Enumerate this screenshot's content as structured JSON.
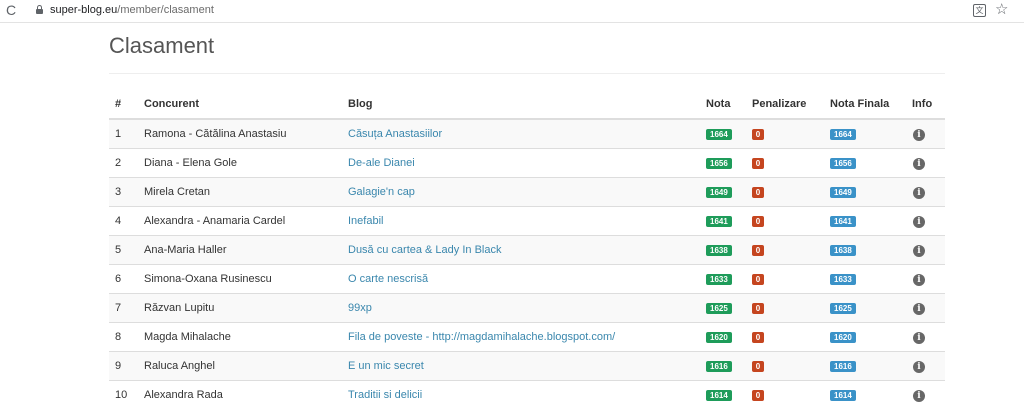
{
  "browser": {
    "url_domain": "super-blog.eu",
    "url_path": "/member/clasament",
    "reload_glyph": "C",
    "translate_glyph": "文",
    "star_glyph": "☆"
  },
  "page": {
    "title": "Clasament"
  },
  "table": {
    "headers": {
      "num": "#",
      "concurent": "Concurent",
      "blog": "Blog",
      "nota": "Nota",
      "penalizare": "Penalizare",
      "nota_finala": "Nota Finala",
      "info": "Info"
    },
    "rows": [
      {
        "num": "1",
        "name": "Ramona - Cătălina Anastasiu",
        "blog": "Căsuța Anastasiilor",
        "nota": "1664",
        "penalizare": "0",
        "nota_finala": "1664",
        "info": "i"
      },
      {
        "num": "2",
        "name": "Diana - Elena Gole",
        "blog": "De-ale Dianei",
        "nota": "1656",
        "penalizare": "0",
        "nota_finala": "1656",
        "info": "i"
      },
      {
        "num": "3",
        "name": "Mirela Cretan",
        "blog": "Galagie'n cap",
        "nota": "1649",
        "penalizare": "0",
        "nota_finala": "1649",
        "info": "i"
      },
      {
        "num": "4",
        "name": "Alexandra - Anamaria Cardel",
        "blog": "Inefabil",
        "nota": "1641",
        "penalizare": "0",
        "nota_finala": "1641",
        "info": "i"
      },
      {
        "num": "5",
        "name": "Ana-Maria Haller",
        "blog": "Dusă cu cartea & Lady In Black",
        "nota": "1638",
        "penalizare": "0",
        "nota_finala": "1638",
        "info": "i"
      },
      {
        "num": "6",
        "name": "Simona-Oxana Rusinescu",
        "blog": "O carte nescrisă",
        "nota": "1633",
        "penalizare": "0",
        "nota_finala": "1633",
        "info": "i"
      },
      {
        "num": "7",
        "name": "Răzvan Lupitu",
        "blog": "99xp",
        "nota": "1625",
        "penalizare": "0",
        "nota_finala": "1625",
        "info": "i"
      },
      {
        "num": "8",
        "name": "Magda Mihalache",
        "blog": "Fila de poveste - http://magdamihalache.blogspot.com/",
        "nota": "1620",
        "penalizare": "0",
        "nota_finala": "1620",
        "info": "i"
      },
      {
        "num": "9",
        "name": "Raluca Anghel",
        "blog": "E un mic secret",
        "nota": "1616",
        "penalizare": "0",
        "nota_finala": "1616",
        "info": "i"
      },
      {
        "num": "10",
        "name": "Alexandra Rada",
        "blog": "Traditii si delicii",
        "nota": "1614",
        "penalizare": "0",
        "nota_finala": "1614",
        "info": "i"
      }
    ]
  },
  "colors": {
    "nota_badge": "#1e9c5a",
    "penalizare_badge": "#c5451f",
    "nota_finala_badge": "#3a92c8",
    "link": "#3a87ad",
    "info_icon": "#676767"
  }
}
